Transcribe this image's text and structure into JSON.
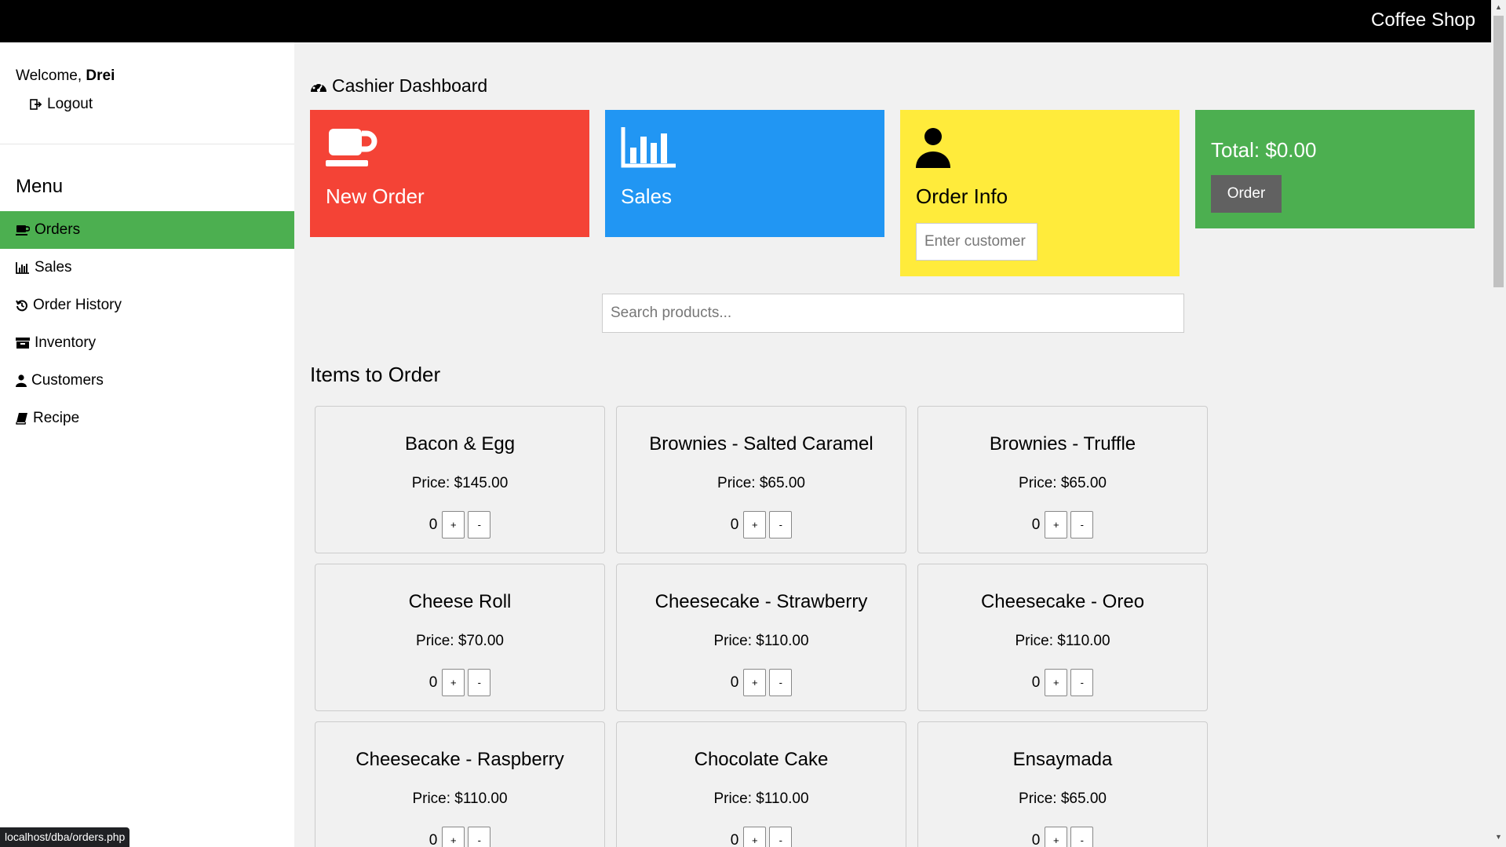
{
  "header": {
    "brand": "Coffee Shop"
  },
  "sidebar": {
    "welcome_prefix": "Welcome,",
    "user_name": "Drei",
    "logout_label": "Logout",
    "menu_title": "Menu",
    "items": [
      {
        "label": "Orders",
        "icon": "coffee-icon",
        "active": true
      },
      {
        "label": "Sales",
        "icon": "bar-chart-icon",
        "active": false
      },
      {
        "label": "Order History",
        "icon": "history-icon",
        "active": false
      },
      {
        "label": "Inventory",
        "icon": "archive-icon",
        "active": false
      },
      {
        "label": "Customers",
        "icon": "user-icon",
        "active": false
      },
      {
        "label": "Recipe",
        "icon": "book-icon",
        "active": false
      }
    ]
  },
  "main": {
    "title": "Cashier Dashboard",
    "cards": {
      "new_order": "New Order",
      "sales": "Sales",
      "order_info": "Order Info",
      "customer_placeholder": "Enter customer",
      "total": "Total: $0.00",
      "order_button": "Order"
    },
    "search_placeholder": "Search products...",
    "section_title": "Items to Order",
    "products": [
      {
        "name": "Bacon & Egg",
        "price": "Price: $145.00",
        "qty": "0"
      },
      {
        "name": "Brownies - Salted Caramel",
        "price": "Price: $65.00",
        "qty": "0"
      },
      {
        "name": "Brownies - Truffle",
        "price": "Price: $65.00",
        "qty": "0"
      },
      {
        "name": "Cheese Roll",
        "price": "Price: $70.00",
        "qty": "0"
      },
      {
        "name": "Cheesecake - Strawberry",
        "price": "Price: $110.00",
        "qty": "0"
      },
      {
        "name": "Cheesecake - Oreo",
        "price": "Price: $110.00",
        "qty": "0"
      },
      {
        "name": "Cheesecake - Raspberry",
        "price": "Price: $110.00",
        "qty": "0"
      },
      {
        "name": "Chocolate Cake",
        "price": "Price: $110.00",
        "qty": "0"
      },
      {
        "name": "Ensaymada",
        "price": "Price: $65.00",
        "qty": "0"
      }
    ],
    "plus_label": "+",
    "minus_label": "-"
  },
  "status_bar": "localhost/dba/orders.php",
  "colors": {
    "topbar": "#000000",
    "active_menu": "#4caf50",
    "new_order": "#f44336",
    "sales": "#2196f3",
    "order_info": "#ffeb3b",
    "total": "#4caf50",
    "order_button": "#616161"
  }
}
